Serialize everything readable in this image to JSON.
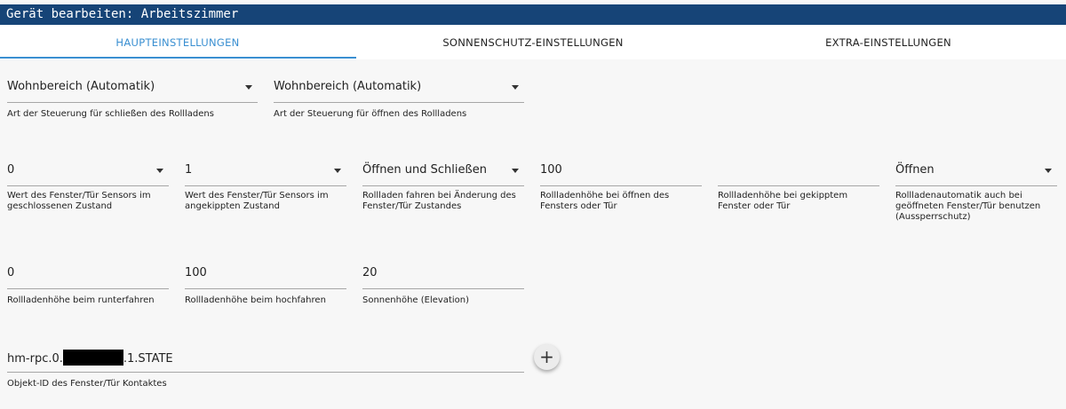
{
  "window": {
    "title": "Gerät bearbeiten: Arbeitszimmer"
  },
  "tabs": [
    {
      "label": "HAUPTEINSTELLUNGEN",
      "active": true
    },
    {
      "label": "SONNENSCHUTZ-EINSTELLUNGEN",
      "active": false
    },
    {
      "label": "EXTRA-EINSTELLUNGEN",
      "active": false
    }
  ],
  "fields": {
    "close_control": {
      "value": "Wohnbereich (Automatik)",
      "label": "Art der Steuerung für schließen des Rollladens"
    },
    "open_control": {
      "value": "Wohnbereich (Automatik)",
      "label": "Art der Steuerung für öffnen des Rollladens"
    },
    "sensor_closed": {
      "value": "0",
      "label": "Wert des Fenster/Tür Sensors im geschlossenen Zustand"
    },
    "sensor_tilted": {
      "value": "1",
      "label": "Wert des Fenster/Tür Sensors im angekippten Zustand"
    },
    "shutter_on_change": {
      "value": "Öffnen und Schließen",
      "label": "Rollladen fahren bei Änderung des Fenster/Tür Zustandes"
    },
    "height_open_window": {
      "value": "100",
      "label": "Rollladenhöhe bei öffnen des Fensters oder Tür"
    },
    "height_tilted_window": {
      "value": "",
      "label": "Rollladenhöhe bei gekipptem Fenster oder Tür"
    },
    "lockout_protection": {
      "value": "Öffnen",
      "label": "Rollladenautomatik auch bei geöffneten Fenster/Tür benutzen (Aussperrschutz)"
    },
    "height_down": {
      "value": "0",
      "label": "Rollladenhöhe beim runterfahren"
    },
    "height_up": {
      "value": "100",
      "label": "Rollladenhöhe beim hochfahren"
    },
    "sun_elevation": {
      "value": "20",
      "label": "Sonnenhöhe (Elevation)"
    },
    "object_id": {
      "prefix": "hm-rpc.0.",
      "suffix": ".1.STATE",
      "label": "Objekt-ID des Fenster/Tür Kontaktes"
    }
  },
  "actions": {
    "add_symbol": "+"
  }
}
